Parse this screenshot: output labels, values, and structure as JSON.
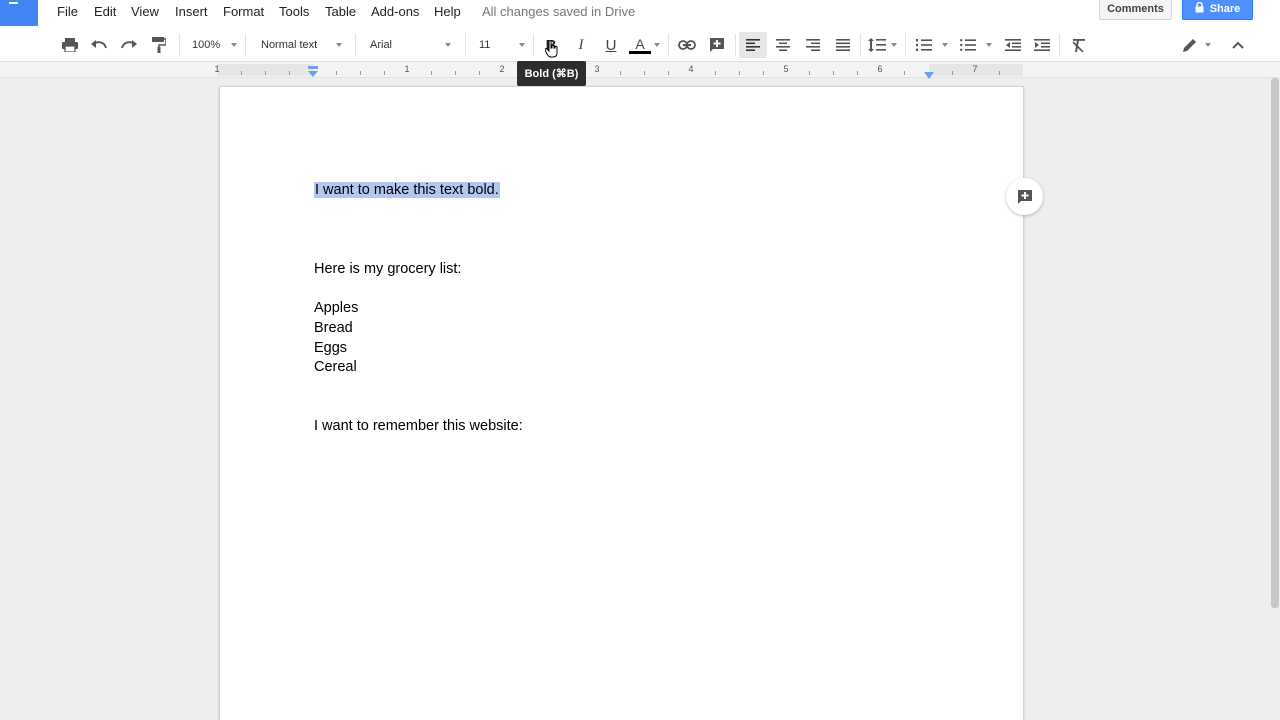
{
  "menu": {
    "items": [
      "File",
      "Edit",
      "View",
      "Insert",
      "Format",
      "Tools",
      "Table",
      "Add-ons",
      "Help"
    ],
    "save_status": "All changes saved in Drive",
    "comments_label": "Comments",
    "share_label": "Share"
  },
  "toolbar": {
    "zoom": "100%",
    "style": "Normal text",
    "font": "Arial",
    "font_size": "11",
    "bold_glyph": "B",
    "italic_glyph": "I",
    "underline_glyph": "U",
    "text_color_glyph": "A",
    "text_color": "#000000"
  },
  "tooltip": "Bold (⌘B)",
  "ruler": {
    "labels": [
      "1",
      "1",
      "2",
      "3",
      "4",
      "5",
      "6",
      "7"
    ]
  },
  "document": {
    "selected_text": "I want to make this text bold.",
    "grocery_intro": "Here is my grocery list:",
    "grocery_items": [
      "Apples",
      "Bread",
      "Eggs",
      "Cereal"
    ],
    "website_line": "I want to remember this website:"
  },
  "colors": {
    "accent": "#4285f4",
    "share_button": "#4d90fe",
    "selection": "#b3c7f2"
  }
}
